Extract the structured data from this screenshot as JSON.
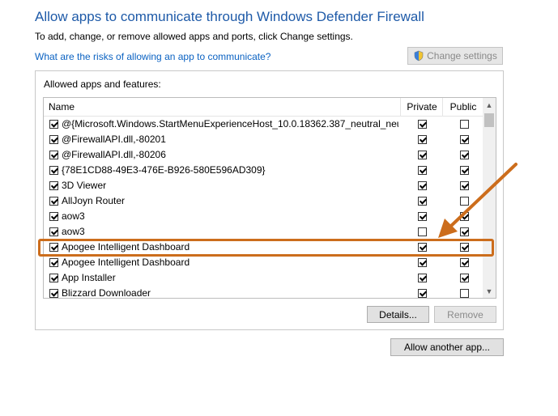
{
  "header": {
    "title": "Allow apps to communicate through Windows Defender Firewall",
    "subtitle": "To add, change, or remove allowed apps and ports, click Change settings.",
    "risk_link": "What are the risks of allowing an app to communicate?",
    "change_settings_label": "Change settings"
  },
  "group": {
    "label": "Allowed apps and features:"
  },
  "table": {
    "columns": {
      "name": "Name",
      "private": "Private",
      "public": "Public"
    },
    "rows": [
      {
        "name": "@{Microsoft.Windows.StartMenuExperienceHost_10.0.18362.387_neutral_neu...",
        "enabled": true,
        "private": true,
        "public": false
      },
      {
        "name": "@FirewallAPI.dll,-80201",
        "enabled": true,
        "private": true,
        "public": true
      },
      {
        "name": "@FirewallAPI.dll,-80206",
        "enabled": true,
        "private": true,
        "public": true
      },
      {
        "name": "{78E1CD88-49E3-476E-B926-580E596AD309}",
        "enabled": true,
        "private": true,
        "public": true
      },
      {
        "name": "3D Viewer",
        "enabled": true,
        "private": true,
        "public": true
      },
      {
        "name": "AllJoyn Router",
        "enabled": true,
        "private": true,
        "public": false
      },
      {
        "name": "aow3",
        "enabled": true,
        "private": true,
        "public": true
      },
      {
        "name": "aow3",
        "enabled": true,
        "private": false,
        "public": true
      },
      {
        "name": "Apogee Intelligent Dashboard",
        "enabled": true,
        "private": true,
        "public": true
      },
      {
        "name": "Apogee Intelligent Dashboard",
        "enabled": true,
        "private": true,
        "public": true
      },
      {
        "name": "App Installer",
        "enabled": true,
        "private": true,
        "public": true
      },
      {
        "name": "Blizzard Downloader",
        "enabled": true,
        "private": true,
        "public": false
      }
    ]
  },
  "buttons": {
    "details": "Details...",
    "remove": "Remove",
    "allow_another": "Allow another app..."
  },
  "icons": {
    "shield": "shield-icon",
    "scroll_up": "scroll-up-icon",
    "scroll_down": "scroll-down-icon"
  },
  "colors": {
    "title": "#1e5aa8",
    "link": "#0b62c2",
    "highlight": "#cc6d1c"
  }
}
